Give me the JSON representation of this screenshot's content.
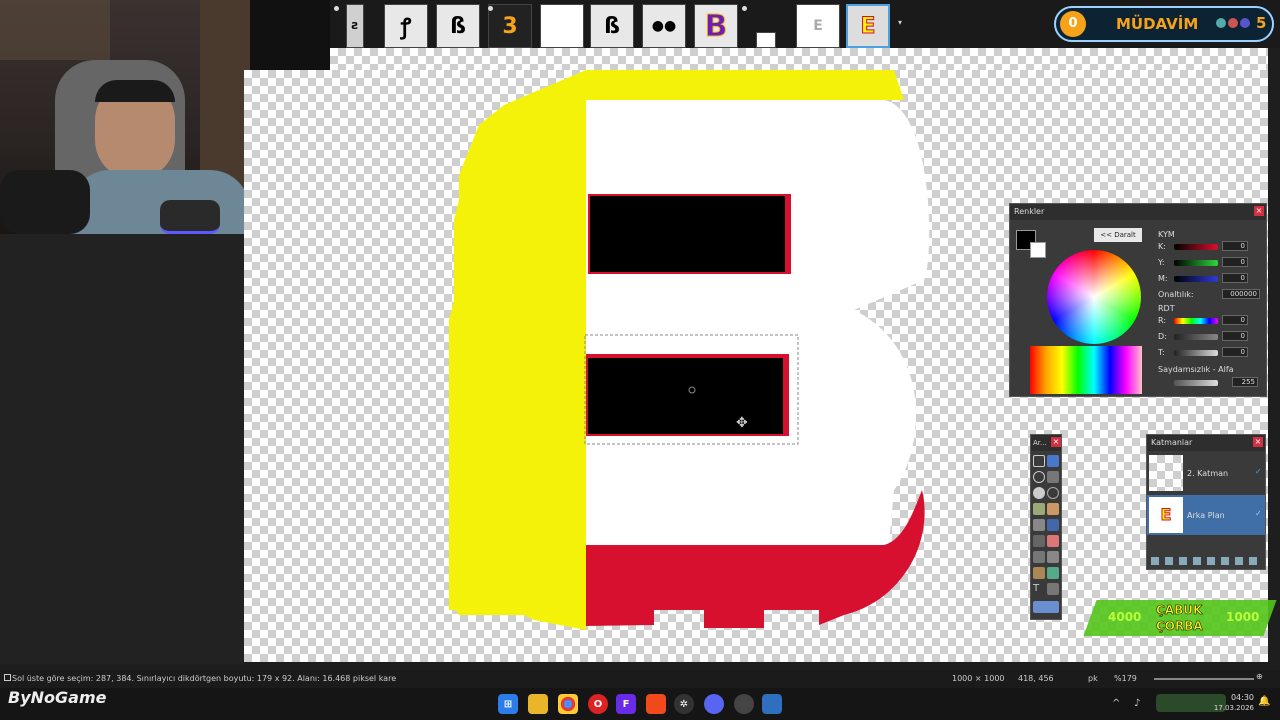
{
  "tabs": [
    {
      "glyph": "Ƨ"
    },
    {
      "glyph": "ꝭ"
    },
    {
      "glyph": "ß"
    },
    {
      "glyph": "3"
    },
    {
      "glyph": ""
    },
    {
      "glyph": "ß"
    },
    {
      "glyph": "●●"
    },
    {
      "glyph": "B"
    },
    {
      "glyph": ""
    },
    {
      "glyph": "E"
    },
    {
      "glyph": "E"
    }
  ],
  "badge": {
    "left_num": "0",
    "label": "MÜDAVİM",
    "right_num": "5"
  },
  "colors_panel": {
    "title": "Renkler",
    "collapse_label": "<< Daralt",
    "cmyk_label": "KYM",
    "cmyk": [
      {
        "key": "K:",
        "value": "0"
      },
      {
        "key": "Y:",
        "value": "0"
      },
      {
        "key": "M:",
        "value": "0"
      }
    ],
    "hex_label": "Onaltılık:",
    "hex_value": "000000",
    "rgb_label": "RDT",
    "rgb": [
      {
        "key": "R:",
        "value": "0"
      },
      {
        "key": "D:",
        "value": "0"
      },
      {
        "key": "T:",
        "value": "0"
      }
    ],
    "alpha_label": "Saydamsızlık - Alfa",
    "alpha_value": "255"
  },
  "tools_panel": {
    "title": "Ar..."
  },
  "layers_panel": {
    "title": "Katmanlar",
    "layers": [
      {
        "name": "2. Katman"
      },
      {
        "name": "Arka Plan"
      }
    ]
  },
  "overlay": {
    "left": "4000",
    "center": "ÇABUK ÇORBA",
    "right": "1000"
  },
  "status": {
    "selection_info": "Sol üste göre seçim: 287, 384. Sınırlayıcı dikdörtgen boyutu: 179 x 92. Alanı: 16.468 piksel kare",
    "image_size": "1000 × 1000",
    "cursor_pos": "418, 456",
    "unit": "pk",
    "zoom": "%179"
  },
  "brand": "ByNoGame",
  "clock": {
    "time": "04:30",
    "date": "17.03.2026"
  },
  "colors": {
    "yellow": "#f5f20a",
    "red": "#d8102f",
    "accent": "#4aa3df"
  }
}
